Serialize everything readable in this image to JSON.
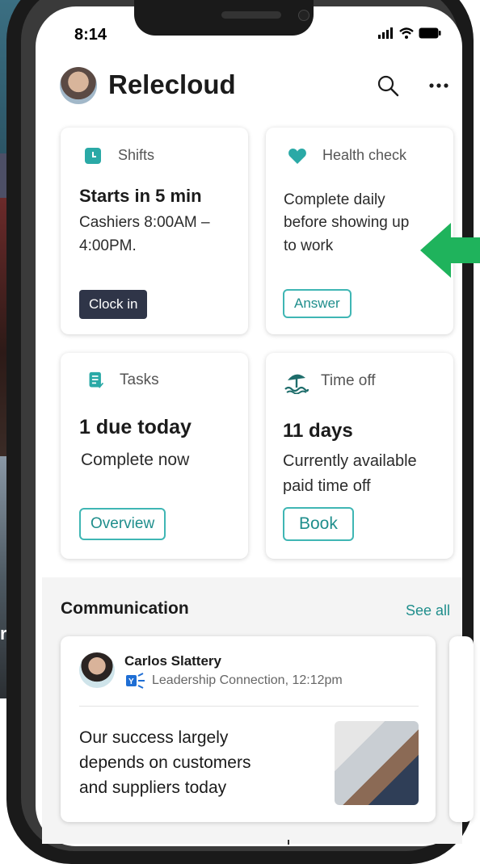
{
  "status_bar": {
    "time": "8:14"
  },
  "header": {
    "app_title": "Relecloud"
  },
  "cards": {
    "shifts": {
      "label": "Shifts",
      "heading": "Starts in 5 min",
      "line1": "Cashiers 8:00AM –",
      "line2": "4:00PM.",
      "button": "Clock in"
    },
    "health": {
      "label": "Health check",
      "line1": "Complete daily",
      "line2": "before showing up",
      "line3": "to work",
      "button": "Answer"
    },
    "tasks": {
      "label": "Tasks",
      "heading": "1 due today",
      "subtext": "Complete now",
      "button": "Overview"
    },
    "timeoff": {
      "label": "Time off",
      "heading": "11 days",
      "line1": "Currently available",
      "line2": "paid time off",
      "button": "Book"
    }
  },
  "communication": {
    "title": "Communication",
    "see_all": "See all",
    "post": {
      "author": "Carlos Slattery",
      "meta": "Leadership Connection, 12:12pm",
      "line1": "Our success largely",
      "line2": "depends on customers",
      "line3": "and suppliers today"
    }
  },
  "colors": {
    "accent": "#3fb6b4",
    "accent_text": "#1f8e8c",
    "dark_button": "#2f3548",
    "arrow": "#1fb35c",
    "heart": "#2aa9a6"
  },
  "icons": [
    "calendar-icon",
    "heart-icon",
    "tasks-icon",
    "beach-icon",
    "search-icon",
    "more-icon",
    "yammer-icon",
    "arrow-left-icon"
  ],
  "background_text": "rc"
}
